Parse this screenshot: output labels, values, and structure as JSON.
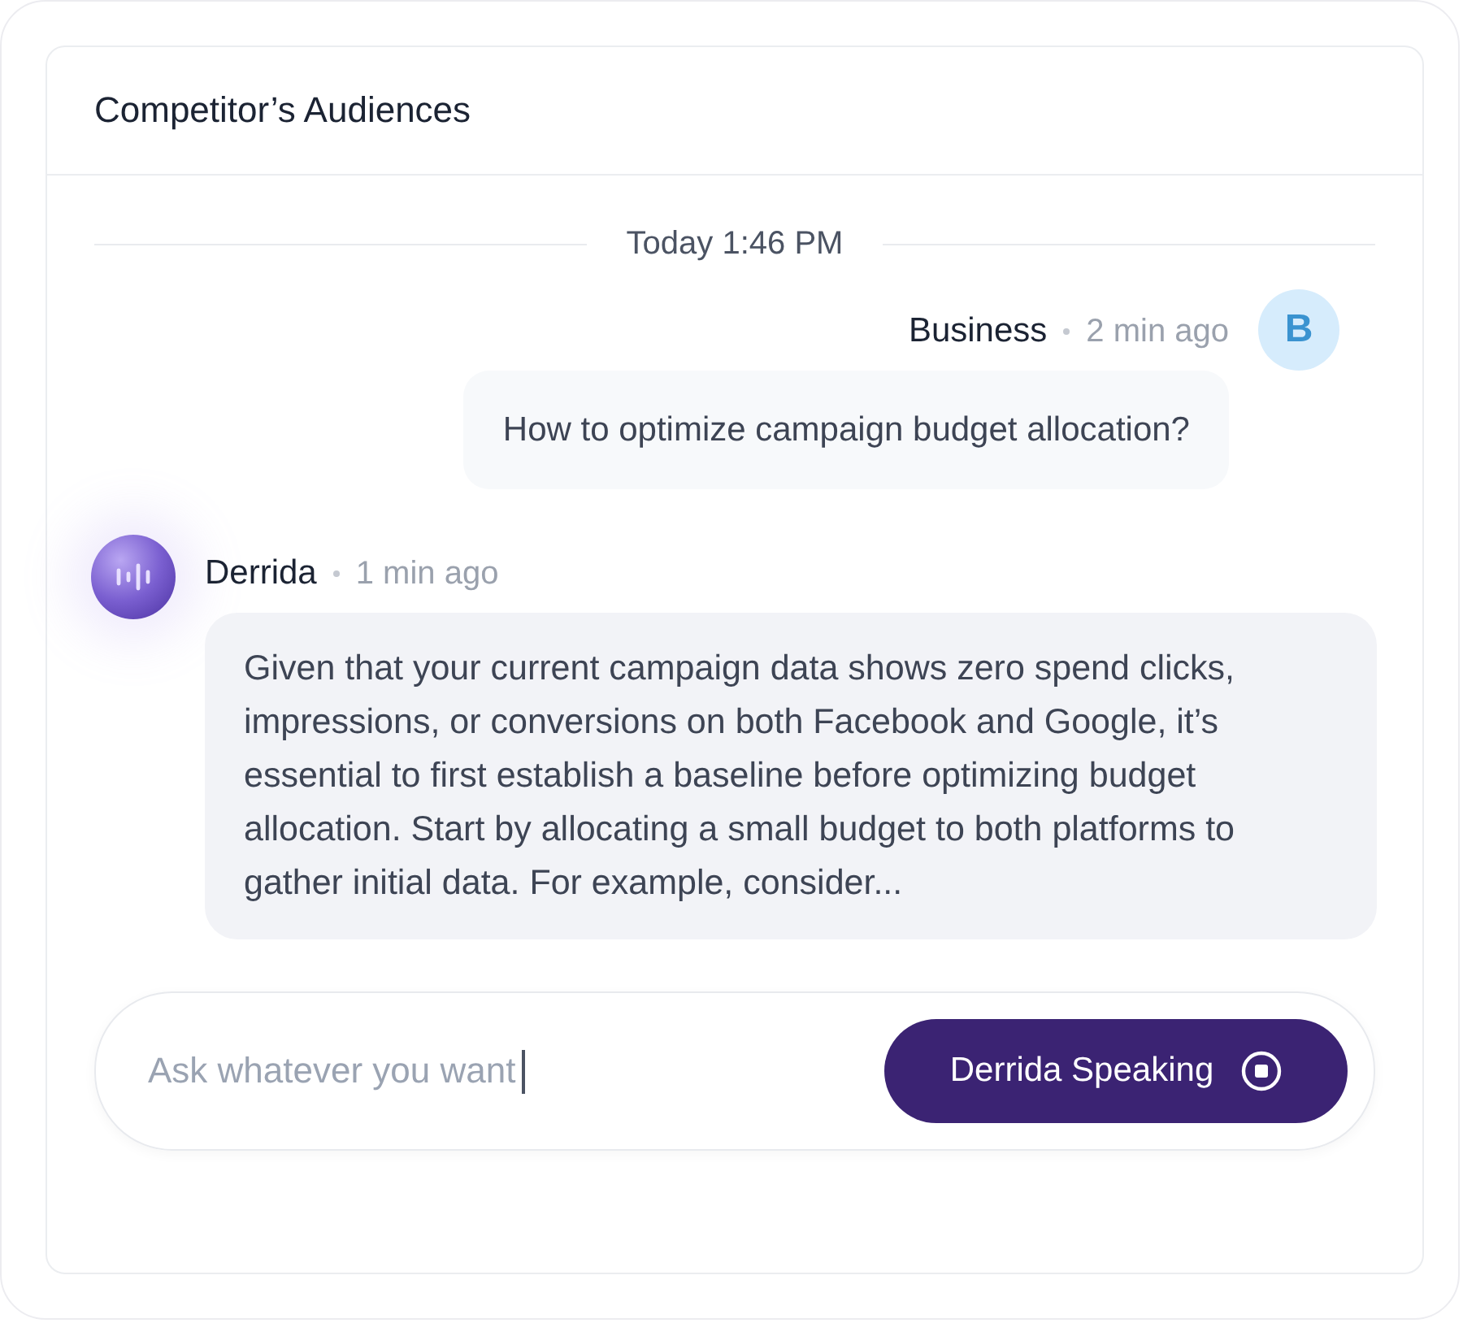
{
  "panel": {
    "title": "Competitor’s Audiences"
  },
  "date_divider": "Today 1:46 PM",
  "messages": [
    {
      "kind": "user",
      "author": "Business",
      "time": "2 min ago",
      "avatar_letter": "B",
      "text": "How to optimize campaign budget allocation?"
    },
    {
      "kind": "assistant",
      "author": "Derrida",
      "time": "1 min ago",
      "text": "Given that your current campaign data shows zero spend clicks, impressions, or conversions on both Facebook and Google, it’s essential to first establish a baseline before optimizing budget allocation. Start by allocating a small budget to both platforms to gather initial data. For example, consider..."
    }
  ],
  "composer": {
    "placeholder": "Ask whatever you want",
    "button": "Derrida Speaking"
  }
}
